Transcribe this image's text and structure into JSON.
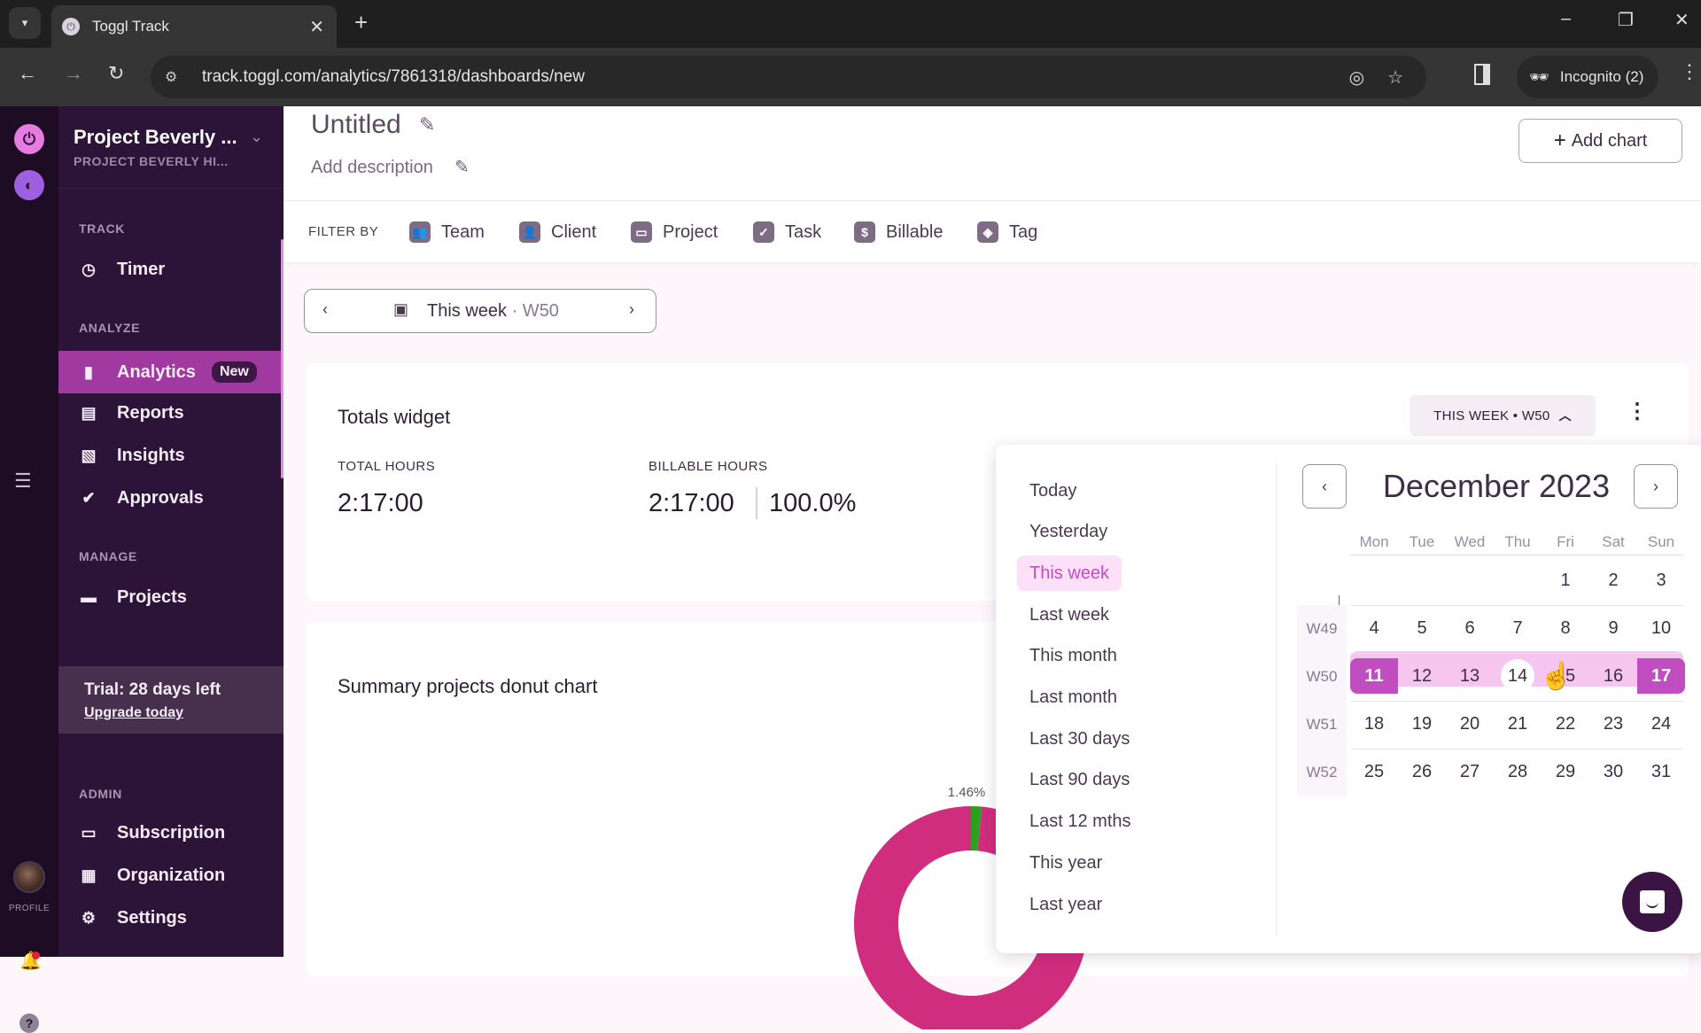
{
  "browser": {
    "tab_title": "Toggl Track",
    "url": "track.toggl.com/analytics/7861318/dashboards/new",
    "incognito_label": "Incognito (2)"
  },
  "sidebar": {
    "workspace_name": "Project Beverly ...",
    "workspace_sub": "PROJECT BEVERLY HI...",
    "sections": {
      "track": "TRACK",
      "analyze": "ANALYZE",
      "manage": "MANAGE",
      "admin": "ADMIN"
    },
    "items": [
      {
        "label": "Timer",
        "icon": "clock-icon"
      },
      {
        "label": "Analytics",
        "icon": "bar-chart-icon",
        "badge": "New",
        "active": true
      },
      {
        "label": "Reports",
        "icon": "report-icon"
      },
      {
        "label": "Insights",
        "icon": "insights-icon"
      },
      {
        "label": "Approvals",
        "icon": "check-circle-icon"
      },
      {
        "label": "Projects",
        "icon": "folder-icon"
      },
      {
        "label": "Subscription",
        "icon": "card-icon"
      },
      {
        "label": "Organization",
        "icon": "building-icon"
      },
      {
        "label": "Settings",
        "icon": "gear-icon"
      }
    ],
    "trial_text": "Trial: 28 days left",
    "upgrade_link": "Upgrade today",
    "profile_label": "PROFILE"
  },
  "header": {
    "title": "Untitled",
    "description_placeholder": "Add description",
    "add_chart_label": "Add chart"
  },
  "filters": {
    "label": "FILTER BY",
    "items": [
      "Team",
      "Client",
      "Project",
      "Task",
      "Billable",
      "Tag"
    ]
  },
  "date_range": {
    "label": "This week",
    "week": "· W50"
  },
  "totals_widget": {
    "title": "Totals widget",
    "period_pill": "THIS WEEK • W50",
    "total_hours_label": "TOTAL HOURS",
    "total_hours_value": "2:17:00",
    "billable_hours_label": "BILLABLE HOURS",
    "billable_hours_value": "2:17:00",
    "billable_percent": "100.0%"
  },
  "donut_widget": {
    "title": "Summary projects donut chart"
  },
  "chart_data": {
    "type": "pie",
    "title": "Summary projects donut chart",
    "donut": true,
    "slices": [
      {
        "label": "",
        "value": 1.46,
        "color": "#2ea01e"
      },
      {
        "label": "",
        "value": 98.54,
        "color": "#d12d7e"
      }
    ],
    "data_labels": [
      "1.46%"
    ]
  },
  "date_picker": {
    "presets": [
      "Today",
      "Yesterday",
      "This week",
      "Last week",
      "This month",
      "Last month",
      "Last 30 days",
      "Last 90 days",
      "Last 12 mths",
      "This year",
      "Last year"
    ],
    "selected_preset": "This week",
    "month_label": "December 2023",
    "weekdays": [
      "Mon",
      "Tue",
      "Wed",
      "Thu",
      "Fri",
      "Sat",
      "Sun"
    ],
    "weeks": [
      {
        "label": "",
        "days": [
          "",
          "",
          "",
          "",
          "1",
          "2",
          "3"
        ]
      },
      {
        "label": "W49",
        "days": [
          "4",
          "5",
          "6",
          "7",
          "8",
          "9",
          "10"
        ]
      },
      {
        "label": "W50",
        "days": [
          "11",
          "12",
          "13",
          "14",
          "15",
          "16",
          "17"
        ]
      },
      {
        "label": "W51",
        "days": [
          "18",
          "19",
          "20",
          "21",
          "22",
          "23",
          "24"
        ]
      },
      {
        "label": "W52",
        "days": [
          "25",
          "26",
          "27",
          "28",
          "29",
          "30",
          "31"
        ]
      }
    ],
    "range_start": "11",
    "range_end": "17",
    "today": "14"
  },
  "colors": {
    "accent": "#c04ec0",
    "sidebar_bg": "#2c1338",
    "active_item": "#a03aa0",
    "range_band": "#f6c6f1"
  }
}
